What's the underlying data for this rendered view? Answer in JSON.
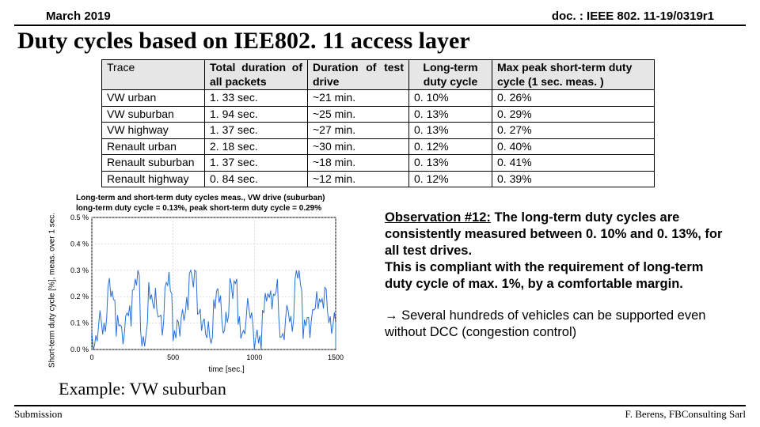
{
  "header": {
    "date": "March 2019",
    "docnum": "doc. : IEEE 802. 11-19/0319r1"
  },
  "title": "Duty cycles based on IEE802. 11 access layer",
  "table_headers": {
    "trace": "Trace",
    "total": "Total duration of all packets",
    "test_drive": "Duration of test drive",
    "long_term": "Long-term duty cycle",
    "peak": "Max peak short-term duty cycle (1 sec. meas. )"
  },
  "rows": [
    {
      "trace": "VW urban",
      "total": "1. 33 sec.",
      "drive": "~21 min.",
      "lt": "0. 10%",
      "peak": "0. 26%"
    },
    {
      "trace": "VW suburban",
      "total": "1. 94 sec.",
      "drive": "~25 min.",
      "lt": "0. 13%",
      "peak": "0. 29%"
    },
    {
      "trace": "VW highway",
      "total": "1. 37 sec.",
      "drive": "~27 min.",
      "lt": "0. 13%",
      "peak": "0. 27%"
    },
    {
      "trace": "Renault urban",
      "total": "2. 18 sec.",
      "drive": "~30 min.",
      "lt": "0. 12%",
      "peak": "0. 40%"
    },
    {
      "trace": "Renault suburban",
      "total": "1. 37 sec.",
      "drive": "~18 min.",
      "lt": "0. 13%",
      "peak": "0. 41%"
    },
    {
      "trace": "Renault highway",
      "total": "0. 84 sec.",
      "drive": "~12 min.",
      "lt": "0. 12%",
      "peak": "0. 39%"
    }
  ],
  "chart": {
    "supertitle": "Long-term and short-term duty cycles meas., VW drive (suburban)",
    "subtitle": "long-term duty cycle = 0.13%, peak short-term duty cycle = 0.29%",
    "ylabel": "Short-term duty cycle [%], meas. over 1 sec.",
    "xlabel": "time [sec.]",
    "yticks": [
      "0.5 %",
      "0.4 %",
      "0.3 %",
      "0.2 %",
      "0.1 %",
      "0.0 %"
    ],
    "xticks": [
      "0",
      "500",
      "1000",
      "1500"
    ]
  },
  "chart_data": {
    "type": "line",
    "title": "Long-term and short-term duty cycles meas., VW drive (suburban)",
    "xlabel": "time [sec.]",
    "ylabel": "Short-term duty cycle [%]",
    "xlim": [
      0,
      1500
    ],
    "ylim": [
      0.0,
      0.5
    ],
    "series": [
      {
        "name": "short-term duty cycle",
        "x": [
          0,
          50,
          100,
          150,
          200,
          250,
          300,
          350,
          400,
          450,
          500,
          550,
          600,
          650,
          700,
          750,
          800,
          850,
          900,
          950,
          1000,
          1050,
          1100,
          1150,
          1200,
          1250,
          1300,
          1350,
          1400,
          1450,
          1500
        ],
        "y": [
          0.04,
          0.1,
          0.22,
          0.08,
          0.12,
          0.26,
          0.05,
          0.2,
          0.11,
          0.24,
          0.07,
          0.15,
          0.29,
          0.12,
          0.05,
          0.19,
          0.1,
          0.25,
          0.08,
          0.14,
          0.03,
          0.18,
          0.21,
          0.07,
          0.12,
          0.27,
          0.09,
          0.16,
          0.2,
          0.11,
          0.06
        ]
      }
    ]
  },
  "caption": "Example: VW suburban",
  "observation": {
    "label": "Observation #12:",
    "line1": " The long-term duty cycles are consistently measured between 0. 10% and 0. 13%, for all test drives.",
    "line2": "This is compliant with the requirement of long-term duty cycle of max. 1%, by a comfortable margin.",
    "arrow": "à",
    "conclusion": " Several hundreds of vehicles can be supported even without DCC (congestion control)"
  },
  "footer": {
    "left": "Submission",
    "right": "F. Berens, FBConsulting Sarl"
  }
}
